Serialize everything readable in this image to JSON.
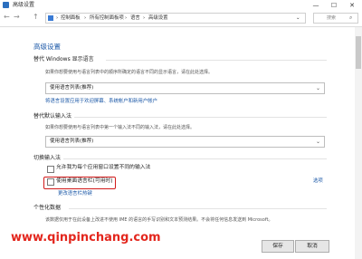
{
  "window": {
    "title": "高级设置",
    "minimize": "—",
    "maximize": "☐",
    "close": "✕"
  },
  "nav": {
    "back": "←",
    "forward": "→",
    "up": "↑",
    "crumbs": [
      "控制面板",
      "所有控制面板项",
      "语言",
      "高级设置"
    ],
    "search_placeholder": "搜索"
  },
  "page": {
    "title": "高级设置",
    "override_display": {
      "heading": "替代 Windows 显示语言",
      "desc": "如果你想要使用与语言列表中的顺序所确定的语言不同的显示语言，请在此处选择。",
      "value": "使用语言列表(推荐)",
      "link": "将语言设置应用于欢迎屏幕、系统帐户和新用户帐户"
    },
    "override_input": {
      "heading": "替代默认输入法",
      "desc": "如果你想要使用与语言列表中第一个输入法不同的输入法，请在此处选择。",
      "value": "使用语言列表(推荐)"
    },
    "switch_input": {
      "heading": "切换输入法",
      "option1": "允许我为每个应用窗口设置不同的输入法",
      "option2": "使用桌面语言栏(可用时)",
      "options_link": "选项",
      "hotkey_link": "更改语言栏热键"
    },
    "personal": {
      "heading": "个性化数据",
      "desc": "该数据仅用于在此设备上改进不使用 IME 的语言的手写识别和文本预测结果。不会将任何信息发送到 Microsoft。"
    }
  },
  "buttons": {
    "save": "保存",
    "cancel": "取消"
  },
  "watermark": "www.qinpinchang.com",
  "colors": {
    "accent": "#1e5aa8",
    "highlight": "#d11a1a"
  }
}
